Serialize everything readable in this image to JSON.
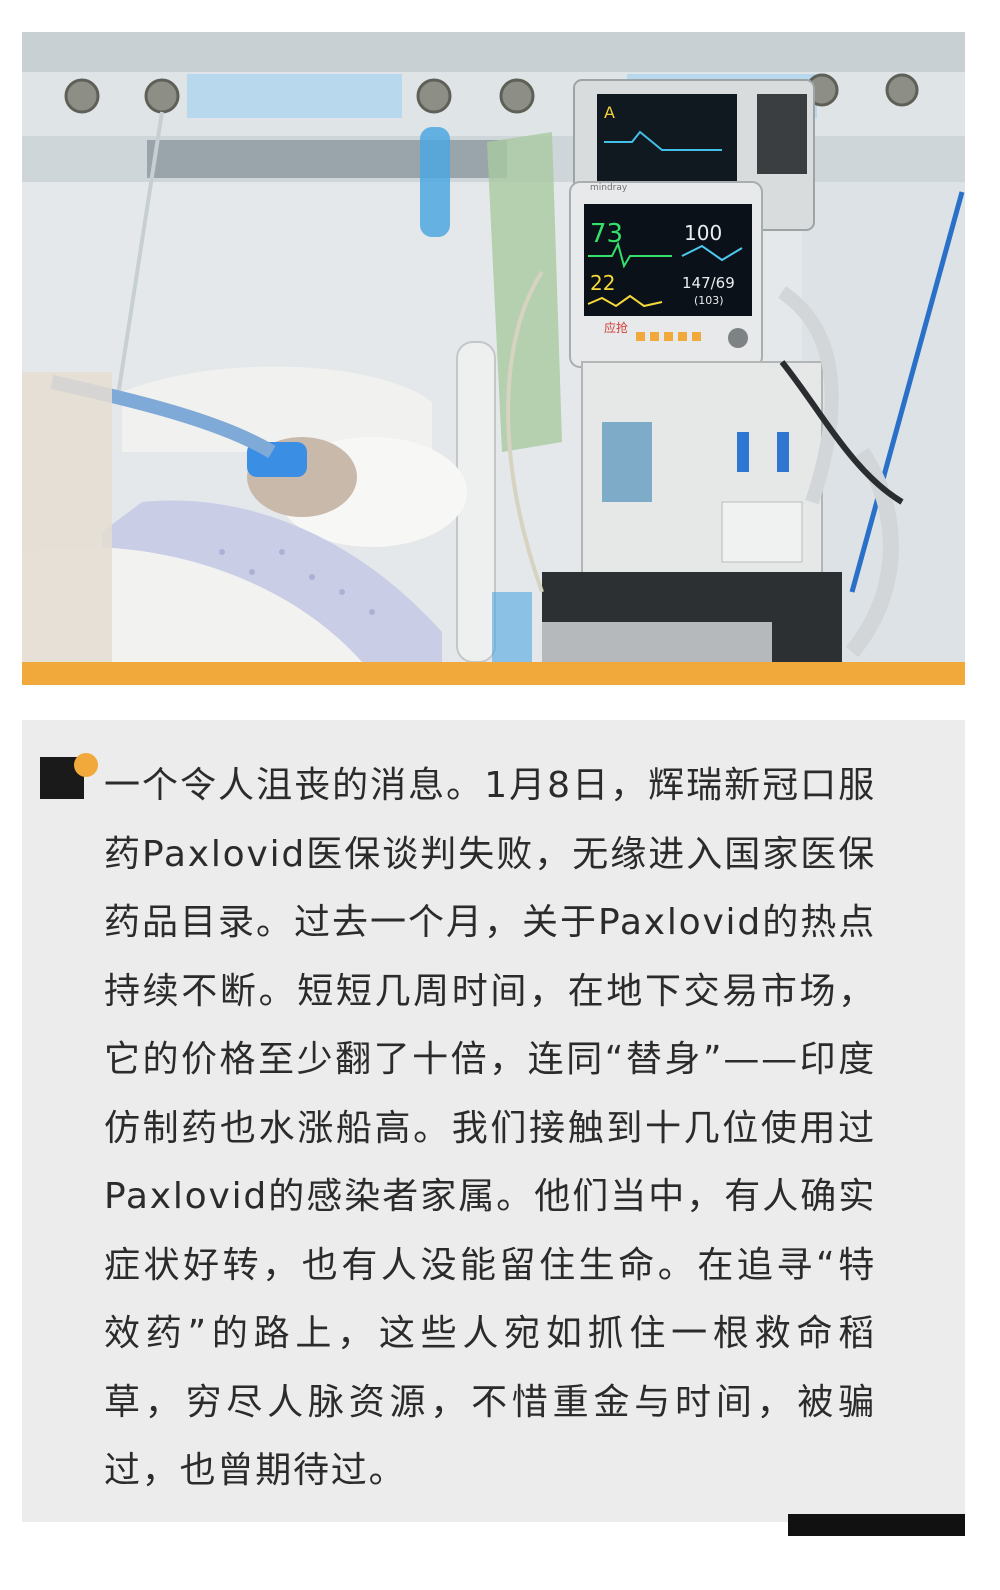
{
  "photo": {
    "monitor": {
      "heart_rate": "73",
      "spo2": "100",
      "resp_rate": "22",
      "blood_pressure": "147/69",
      "mean_pressure": "(103)",
      "alarm_label": "应抢",
      "brand": "mindray"
    },
    "ventilator_screen_label": "A"
  },
  "caption": {
    "text": "一个令人沮丧的消息。1月8日，辉瑞新冠口服药Paxlovid医保谈判失败，无缘进入国家医保药品目录。过去一个月，关于Paxlovid的热点持续不断。短短几周时间，在地下交易市场，它的价格至少翻了十倍，连同“替身”——印度仿制药也水涨船高。我们接触到十几位使用过Paxlovid的感染者家属。他们当中，有人确实症状好转，也有人没能留住生命。在追寻“特效药”的路上，这些人宛如抓住一根救命稻草，穷尽人脉资源，不惜重金与时间，被骗过，也曾期待过。"
  },
  "colors": {
    "accent": "#f2a93b",
    "caption_bg": "#ececec",
    "text": "#2b2b2b"
  }
}
